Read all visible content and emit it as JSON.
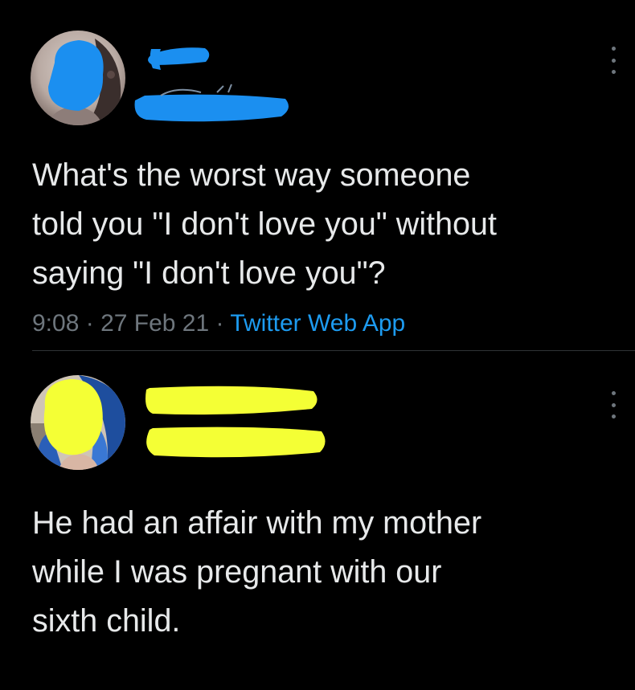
{
  "tweets": [
    {
      "text_lines": [
        "What's the worst way someone",
        "told you \"I don't love you\" without",
        "saying \"I don't love you\"?"
      ],
      "time": "9:08",
      "separator": "·",
      "date": "27 Feb 21",
      "source": "Twitter Web App",
      "censor_color": "#1b8ff0",
      "avatar_icon": "user-avatar-icon",
      "more_icon": "more-options-icon"
    },
    {
      "text_lines": [
        "He had an affair with my mother",
        "while I was pregnant with our",
        "sixth child."
      ],
      "censor_color": "#f4ff35",
      "avatar_icon": "user-avatar-icon",
      "more_icon": "more-options-icon"
    }
  ],
  "colors": {
    "background": "#000000",
    "text": "#e7e9ea",
    "muted": "#6e767d",
    "link": "#1d9bf0",
    "divider": "#2f3336"
  }
}
